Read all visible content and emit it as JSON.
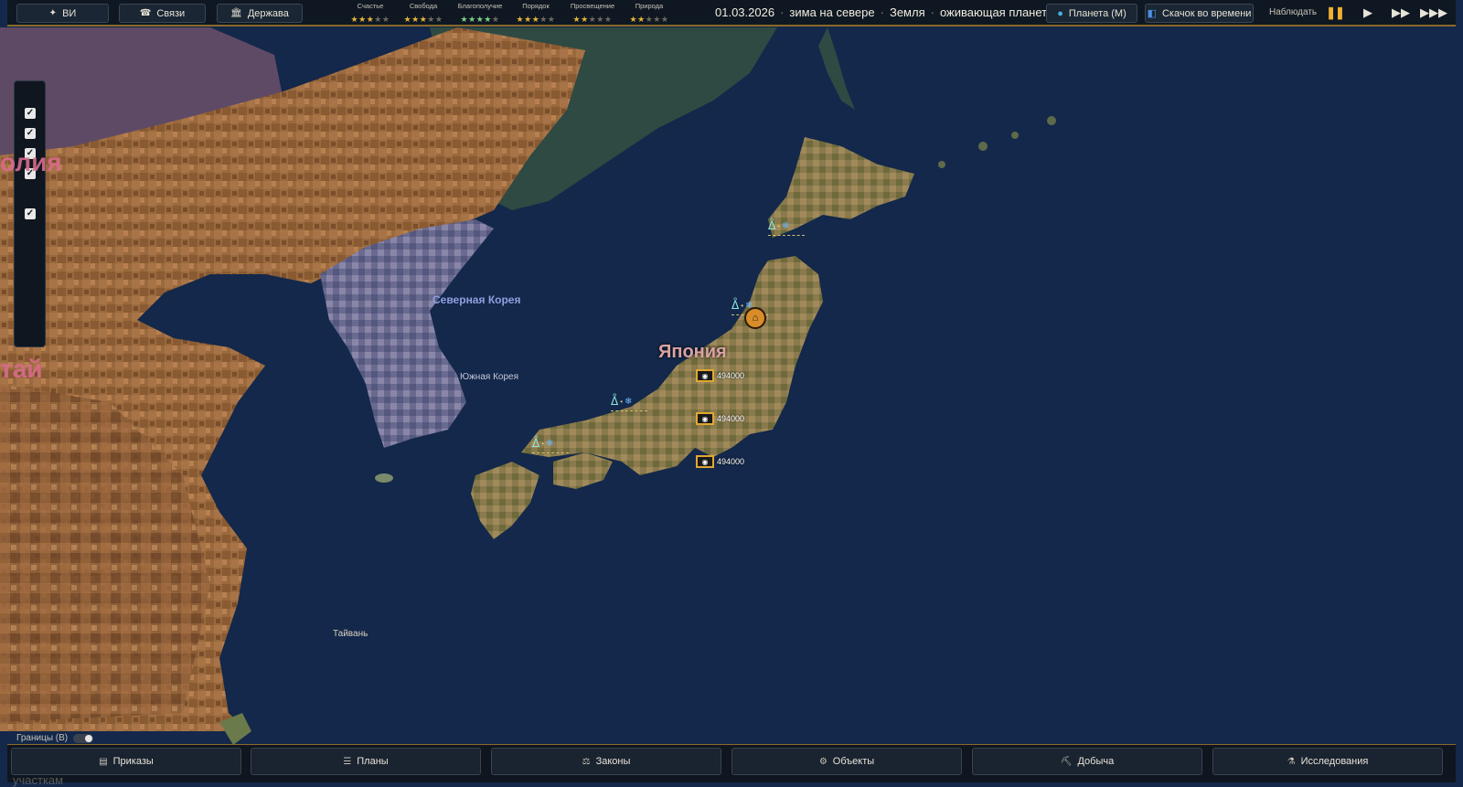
{
  "top_left_buttons": [
    {
      "icon": "✦",
      "label": "ВИ"
    },
    {
      "icon": "☎",
      "label": "Связи"
    },
    {
      "icon": "🏛",
      "label": "Держава"
    }
  ],
  "stats": [
    {
      "label": "Счастье",
      "stars": 3
    },
    {
      "label": "Свобода",
      "stars": 3
    },
    {
      "label": "Благополучие",
      "stars": 4
    },
    {
      "label": "Порядок",
      "stars": 3
    },
    {
      "label": "Просвещение",
      "stars": 2
    },
    {
      "label": "Природа",
      "stars": 2
    }
  ],
  "status": {
    "date": "01.03.2026",
    "season": "зима на севере",
    "planet": "Земля",
    "planet_state": "оживающая планета"
  },
  "top_right_buttons": {
    "planet_view": "Планета (M)",
    "time_jump": "Скачок во времени",
    "observe": "Наблюдать"
  },
  "side_panel_checks": [
    true,
    true,
    true,
    true,
    true
  ],
  "map_labels": {
    "mongolia_partial": "олия",
    "china_partial": "тай",
    "north_korea": "Северная Корея",
    "south_korea": "Южная Корея",
    "japan": "Япония",
    "taiwan": "Тайвань"
  },
  "unit_badges": [
    "494000",
    "494000",
    "494000"
  ],
  "borders_toggle": "Границы (B)",
  "bottom_tabs": [
    {
      "icon": "▤",
      "label": "Приказы"
    },
    {
      "icon": "☰",
      "label": "Планы"
    },
    {
      "icon": "⚖",
      "label": "Законы"
    },
    {
      "icon": "⚙",
      "label": "Объекты"
    },
    {
      "icon": "⛏",
      "label": "Добыча"
    },
    {
      "icon": "⚗",
      "label": "Исследования"
    }
  ],
  "bottom_cutoff_text": "участкам",
  "colors": {
    "ocean": "#13284a",
    "accent_gold": "#e0a830",
    "bar_bg": "#0f1620"
  }
}
